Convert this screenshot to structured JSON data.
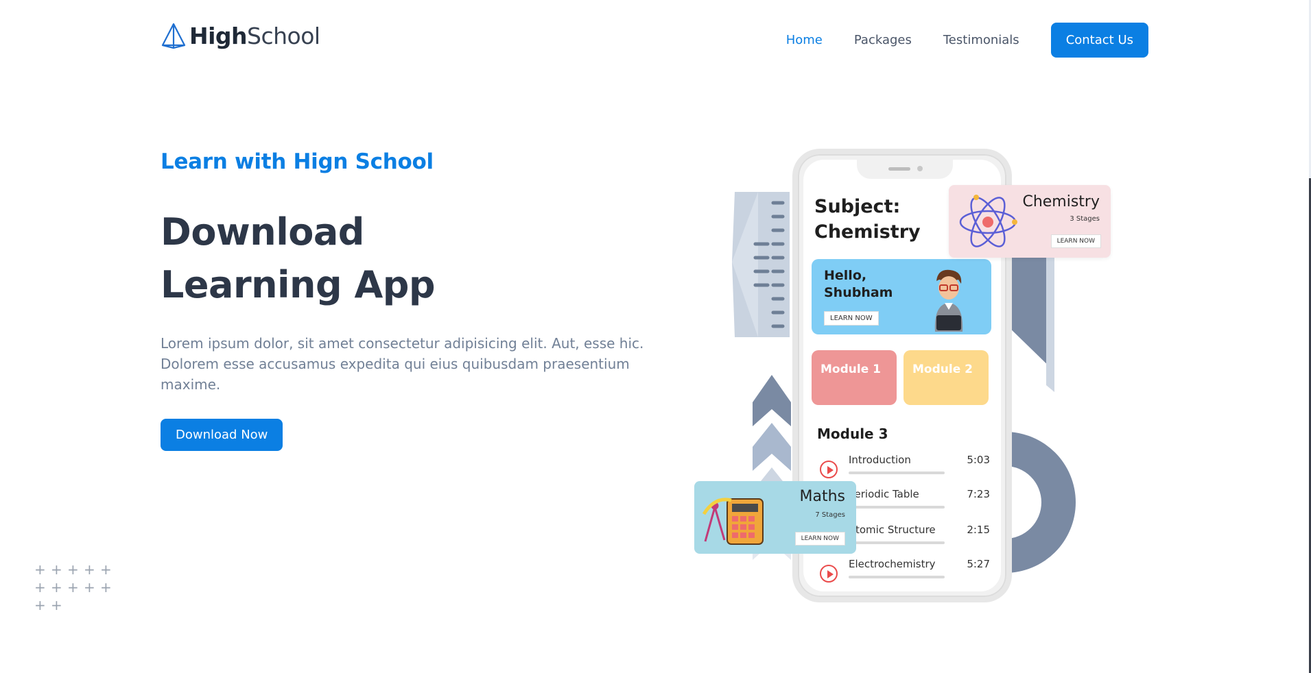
{
  "brand": {
    "logo_bold": "High",
    "logo_light": "School"
  },
  "nav": {
    "items": [
      {
        "label": "Home",
        "active": true
      },
      {
        "label": "Packages",
        "active": false
      },
      {
        "label": "Testimonials",
        "active": false
      }
    ],
    "contact_label": "Contact Us"
  },
  "hero": {
    "kicker": "Learn with Hign School",
    "title_line1": "Download",
    "title_line2": "Learning App",
    "text": "Lorem ipsum dolor, sit amet consectetur adipisicing elit. Aut, esse hic. Dolorem esse accusamus expedita qui eius quibusdam praesentium maxime.",
    "cta_label": "Download Now"
  },
  "colors": {
    "accent": "#0b7fe3",
    "heading": "#2d3748",
    "body": "#718096",
    "highlight": "#cfe4f8"
  },
  "illustration": {
    "phone": {
      "subject_line1": "Subject:",
      "subject_line2": "Chemistry",
      "greeting_line1": "Hello,",
      "greeting_line2": "Shubham",
      "learn_now": "LEARN NOW",
      "module_1": "Module 1",
      "module_2": "Module 2",
      "module_3": "Module 3",
      "lessons": [
        {
          "name": "Introduction",
          "time": "5:03"
        },
        {
          "name": "Periodic Table",
          "time": "7:23"
        },
        {
          "name": "Atomic Structure",
          "time": "2:15"
        },
        {
          "name": "Electrochemistry",
          "time": "5:27"
        }
      ]
    },
    "chemistry_card": {
      "title": "Chemistry",
      "stages": "3 Stages",
      "learn_now": "LEARN NOW"
    },
    "maths_card": {
      "title": "Maths",
      "stages": "7 Stages",
      "learn_now": "LEARN NOW"
    }
  },
  "icons": [
    "logo-pyramid-icon",
    "play-icon",
    "atom-icon",
    "calculator-icon",
    "compass-icon",
    "avatar-icon",
    "plus-icon"
  ]
}
